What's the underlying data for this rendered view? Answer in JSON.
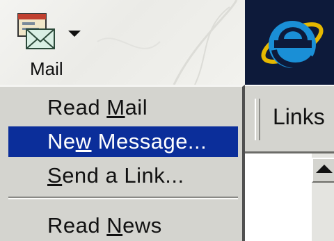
{
  "toolbar": {
    "mail_button": {
      "label": "Mail",
      "icon": "mail-envelope-icon",
      "dropdown_icon": "dropdown-arrow-icon"
    }
  },
  "logo": {
    "icon": "internet-explorer-logo-icon",
    "brand_color": "#1a8fd6"
  },
  "links_bar": {
    "label": "Links"
  },
  "menu": {
    "highlight_color": "#0b2e9a",
    "items": [
      {
        "before": "Read ",
        "mnemonic": "M",
        "after": "ail",
        "highlighted": false
      },
      {
        "before": "Ne",
        "mnemonic": "w",
        "after": " Message...",
        "highlighted": true
      },
      {
        "before": "",
        "mnemonic": "S",
        "after": "end a Link...",
        "highlighted": false
      },
      {
        "before": "Read ",
        "mnemonic": "N",
        "after": "ews",
        "highlighted": false
      }
    ]
  }
}
